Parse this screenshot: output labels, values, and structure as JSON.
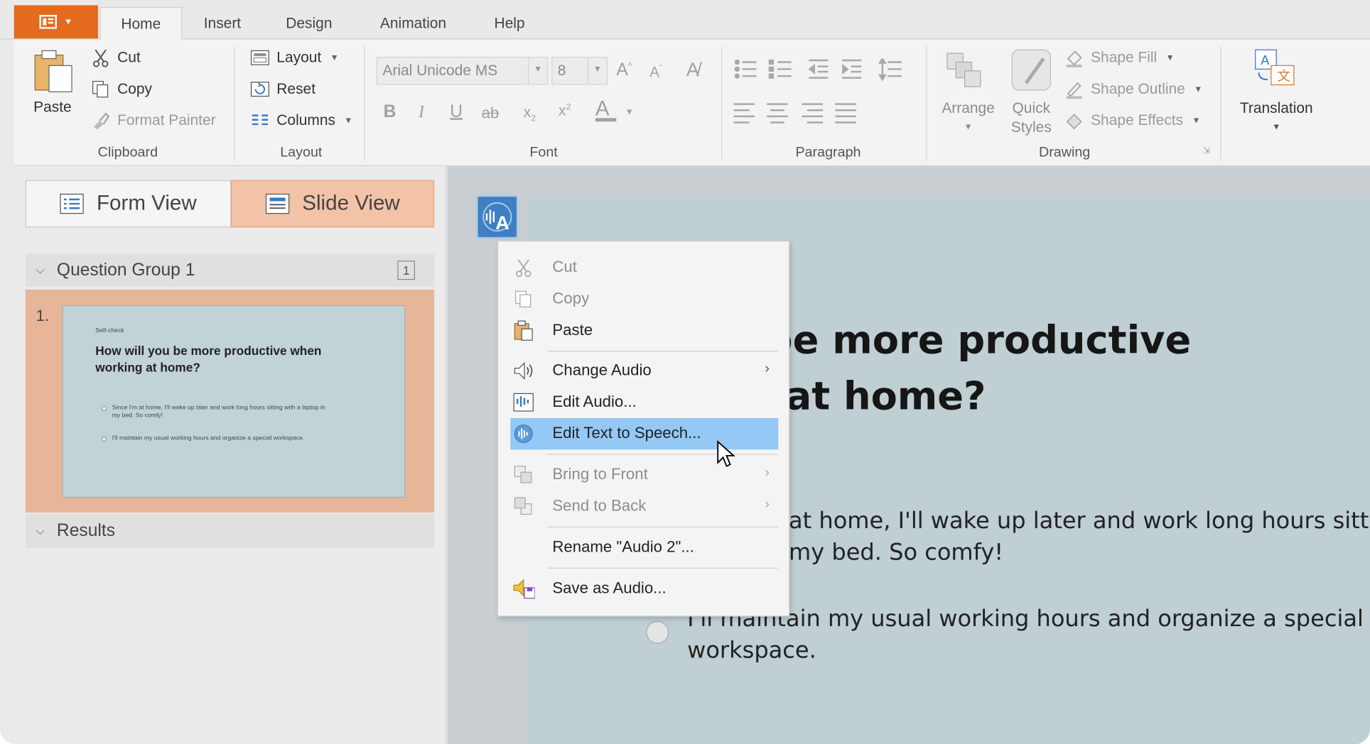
{
  "ribbon": {
    "tabs": [
      "Home",
      "Insert",
      "Design",
      "Animation",
      "Help"
    ],
    "active_tab": "Home",
    "clipboard": {
      "paste": "Paste",
      "cut": "Cut",
      "copy": "Copy",
      "format_painter": "Format Painter",
      "label": "Clipboard"
    },
    "layout": {
      "layout": "Layout",
      "reset": "Reset",
      "columns": "Columns",
      "label": "Layout"
    },
    "font": {
      "family": "Arial Unicode MS",
      "size": "8",
      "label": "Font"
    },
    "paragraph": {
      "label": "Paragraph"
    },
    "drawing": {
      "arrange": "Arrange",
      "quick_styles_1": "Quick",
      "quick_styles_2": "Styles",
      "shape_fill": "Shape Fill",
      "shape_outline": "Shape Outline",
      "shape_effects": "Shape Effects",
      "label": "Drawing"
    },
    "translation": {
      "label": "Translation"
    }
  },
  "left_panel": {
    "form_view": "Form View",
    "slide_view": "Slide View",
    "group_title": "Question Group 1",
    "group_count": "1",
    "slide_number": "1.",
    "thumb": {
      "eyebrow": "Self-check",
      "title": "How will you be more productive when working at home?",
      "options": [
        "Since I'm at home, I'll wake up later and work long hours sitting with a laptop in my bed. So comfy!",
        "I'll maintain my usual working hours and organize a special workspace."
      ]
    },
    "results": "Results"
  },
  "slide": {
    "title_line1": "ll you be more productive",
    "title_line2": "orking at home?",
    "option1_line1": "at home, I'll wake up later and work long hours sitting",
    "option1_line2": "my bed. So comfy!",
    "option2_line1": "I'll maintain my usual working hours and organize a special",
    "option2_line2": "workspace."
  },
  "context_menu": {
    "cut": "Cut",
    "copy": "Copy",
    "paste": "Paste",
    "change_audio": "Change Audio",
    "edit_audio": "Edit Audio...",
    "edit_tts": "Edit Text to Speech...",
    "bring_front": "Bring to Front",
    "send_back": "Send to Back",
    "rename": "Rename \"Audio 2\"...",
    "save_audio": "Save as Audio..."
  },
  "colors": {
    "accent": "#e46a1f",
    "highlight": "#94c8f5",
    "slide_bg": "#bfcfd3"
  }
}
